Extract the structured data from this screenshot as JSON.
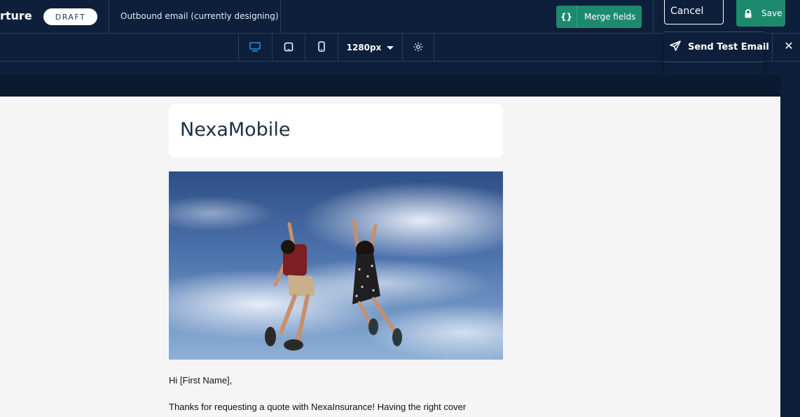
{
  "header": {
    "title": "rture",
    "status_badge": "DRAFT",
    "email_name": "Outbound email (currently designing)",
    "merge_fields_label": "Merge fields",
    "cancel_label": "Cancel",
    "save_label": "Save"
  },
  "toolbar": {
    "width_value": "1280px"
  },
  "popover": {
    "send_test_label": "Send Test Email"
  },
  "email": {
    "brand_name": "NexaMobile",
    "greeting": "Hi [First Name],",
    "body_line_1": "Thanks for requesting a quote with NexaInsurance! Having the right cover"
  },
  "colors": {
    "topbar_bg": "#0d1f3a",
    "accent_green": "#1d8a6e",
    "active_device": "#2d8fe6"
  }
}
